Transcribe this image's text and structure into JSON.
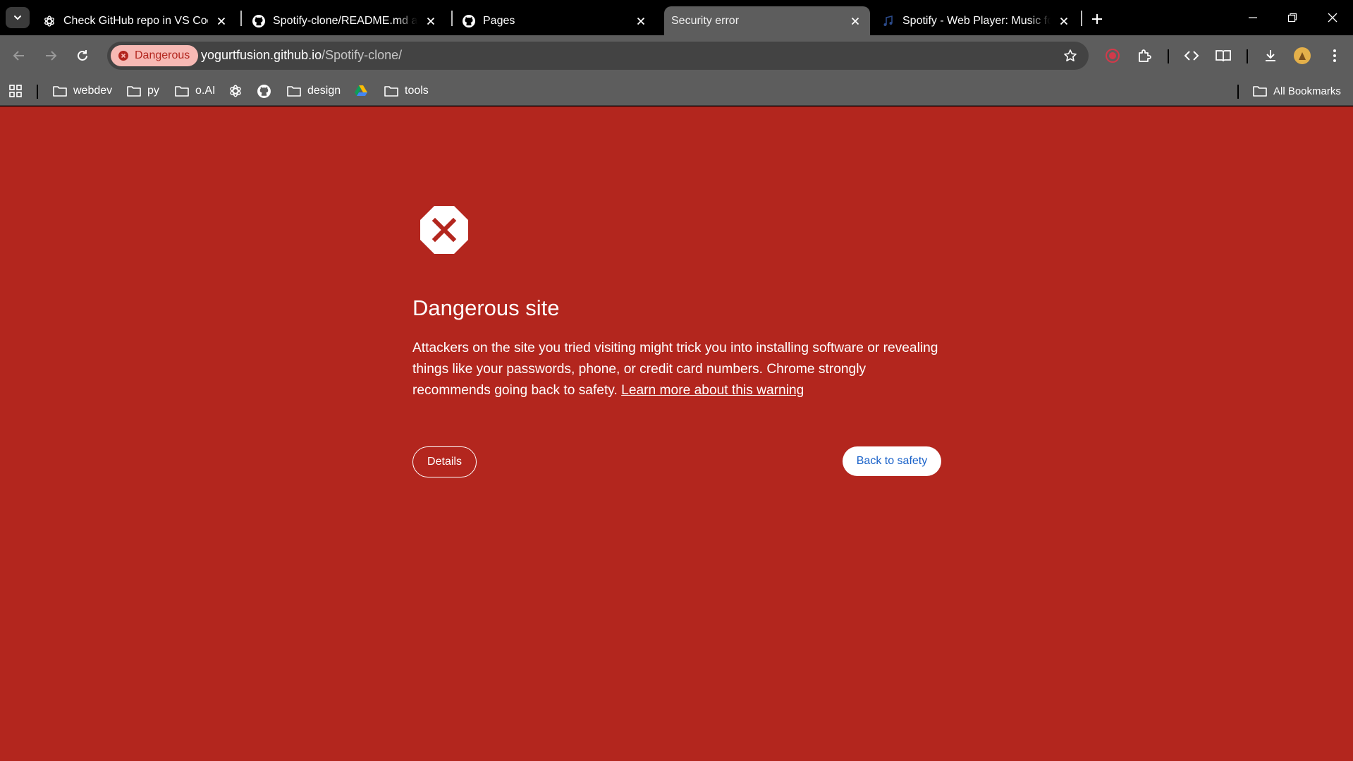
{
  "tabs": [
    {
      "title": "Check GitHub repo in VS Code",
      "icon": "openai-icon"
    },
    {
      "title": "Spotify-clone/README.md at m",
      "icon": "github-icon"
    },
    {
      "title": "Pages",
      "icon": "github-icon"
    },
    {
      "title": "Security error",
      "icon": "none",
      "active": true
    },
    {
      "title": "Spotify - Web Player: Music for",
      "icon": "spotify-audio-icon"
    }
  ],
  "toolbar": {
    "security_chip": "Dangerous",
    "url_host": "yogurtfusion.github.io",
    "url_path": "/Spotify-clone/"
  },
  "bookmarks": {
    "items": [
      {
        "label": "webdev",
        "icon": "folder-icon"
      },
      {
        "label": "py",
        "icon": "folder-icon"
      },
      {
        "label": "o.AI",
        "icon": "folder-icon"
      },
      {
        "label": "",
        "icon": "openai-icon"
      },
      {
        "label": "",
        "icon": "github-icon"
      },
      {
        "label": "design",
        "icon": "folder-icon"
      },
      {
        "label": "",
        "icon": "google-drive-icon"
      },
      {
        "label": "tools",
        "icon": "folder-icon"
      }
    ],
    "all_bookmarks": "All Bookmarks"
  },
  "interstitial": {
    "heading": "Dangerous site",
    "body": "Attackers on the site you tried visiting might trick you into installing software or revealing things like your passwords, phone, or credit card numbers. Chrome strongly recommends going back to safety.",
    "learn_more": "Learn more about this warning",
    "details_button": "Details",
    "back_button": "Back to safety"
  },
  "colors": {
    "danger_red": "#b3261e",
    "chip_bg": "#f7b9b4",
    "link_blue": "#1a62c9",
    "toolbar_gray": "#5d5d5d"
  }
}
